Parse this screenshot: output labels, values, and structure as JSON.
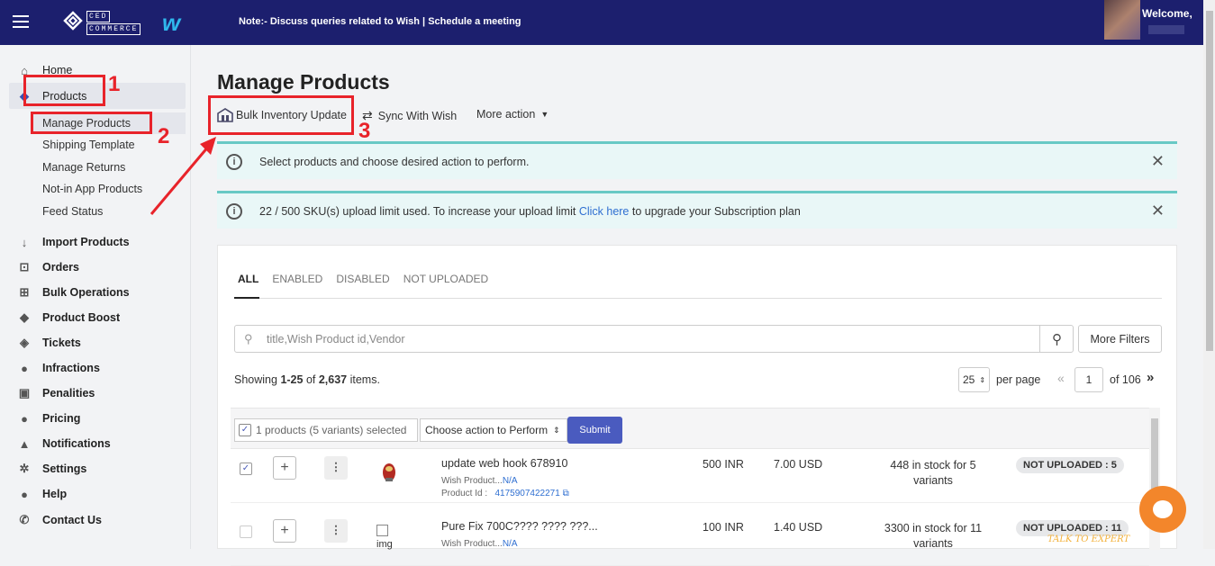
{
  "topbar": {
    "note_prefix": "Note:- Discuss queries related to Wish | ",
    "note_link": "Schedule a meeting",
    "welcome": "Welcome,",
    "logo_line1": "CED",
    "logo_line2": "COMMERCE"
  },
  "sidebar": {
    "home": "Home",
    "products": "Products",
    "manage_products": "Manage Products",
    "shipping_template": "Shipping Template",
    "manage_returns": "Manage Returns",
    "not_in_app": "Not-in App Products",
    "feed_status": "Feed Status",
    "import_products": "Import Products",
    "orders": "Orders",
    "bulk_operations": "Bulk Operations",
    "product_boost": "Product Boost",
    "tickets": "Tickets",
    "infractions": "Infractions",
    "penalities": "Penalities",
    "pricing": "Pricing",
    "notifications": "Notifications",
    "settings": "Settings",
    "help": "Help",
    "contact_us": "Contact Us"
  },
  "annotations": {
    "n1": "1",
    "n2": "2",
    "n3": "3"
  },
  "main": {
    "title": "Manage Products",
    "bulk_inventory": "Bulk Inventory Update",
    "sync": "Sync With Wish",
    "more_action": "More action"
  },
  "banners": {
    "b1": "Select products and choose desired action to perform.",
    "b2_pre": "22 / 500 SKU(s) upload limit used. To increase your upload limit ",
    "b2_link": "Click here",
    "b2_post": " to upgrade your Subscription plan"
  },
  "tabs": [
    "ALL",
    "ENABLED",
    "DISABLED",
    "NOT UPLOADED"
  ],
  "search": {
    "placeholder": "title,Wish Product id,Vendor",
    "more_filters": "More Filters"
  },
  "listing": {
    "showing_pre": "Showing ",
    "showing_range": "1-25",
    "showing_mid": " of ",
    "showing_total": "2,637",
    "showing_post": " items.",
    "per_page_value": "25",
    "per_page_label": "per page",
    "page": "1",
    "of_pages": "of 106"
  },
  "bulk": {
    "selected": "1 products (5 variants) selected",
    "action": "Choose action to Perform",
    "submit": "Submit"
  },
  "rows": [
    {
      "title": "update web hook 678910",
      "wish_label": "Wish Product...",
      "wish_value": "N/A",
      "pid_label": "Product Id :",
      "pid_value": "4175907422271",
      "price": "500 INR",
      "usd": "7.00 USD",
      "stock": "448 in stock for 5 variants",
      "badge": "NOT UPLOADED : 5",
      "checked": "✓"
    },
    {
      "title": "Pure Fix 700C???? ???? ???...",
      "wish_label": "Wish Product...",
      "wish_value": "N/A",
      "price": "100 INR",
      "usd": "1.40 USD",
      "stock": "3300 in stock for 11 variants",
      "badge": "NOT UPLOADED : 11",
      "img_alt": "img"
    }
  ],
  "chat": {
    "talk": "TALK TO EXPERT"
  },
  "colors": {
    "topbar": "#1c1f6e",
    "accent": "#4a5bbf",
    "annotation": "#e8232a",
    "banner_border": "#68c9c5"
  }
}
